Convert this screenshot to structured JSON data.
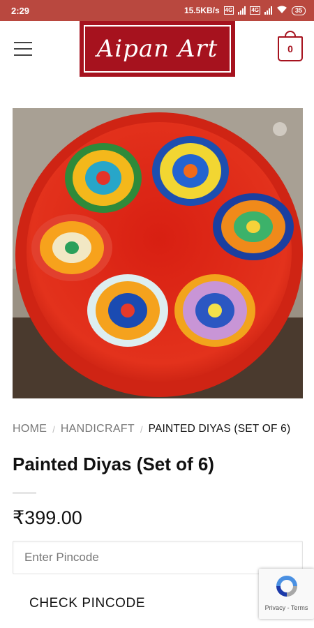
{
  "status_bar": {
    "time": "2:29",
    "network_speed": "15.5KB/s",
    "battery": "35"
  },
  "header": {
    "logo_text": "Aipan Art",
    "cart_count": "0"
  },
  "breadcrumb": {
    "items": [
      "HOME",
      "HANDICRAFT"
    ],
    "separator": "/",
    "current": "PAINTED DIYAS (SET OF 6)"
  },
  "product": {
    "title": "Painted Diyas (Set of 6)",
    "price": "₹399.00",
    "image_alt": "Painted Diyas (Set of 6)"
  },
  "pincode": {
    "placeholder": "Enter Pincode",
    "value": "",
    "button_label": "CHECK PINCODE"
  },
  "recaptcha": {
    "privacy": "Privacy",
    "separator": " - ",
    "terms": "Terms"
  },
  "colors": {
    "brand": "#a6121e",
    "status_bar": "#b9483f"
  }
}
